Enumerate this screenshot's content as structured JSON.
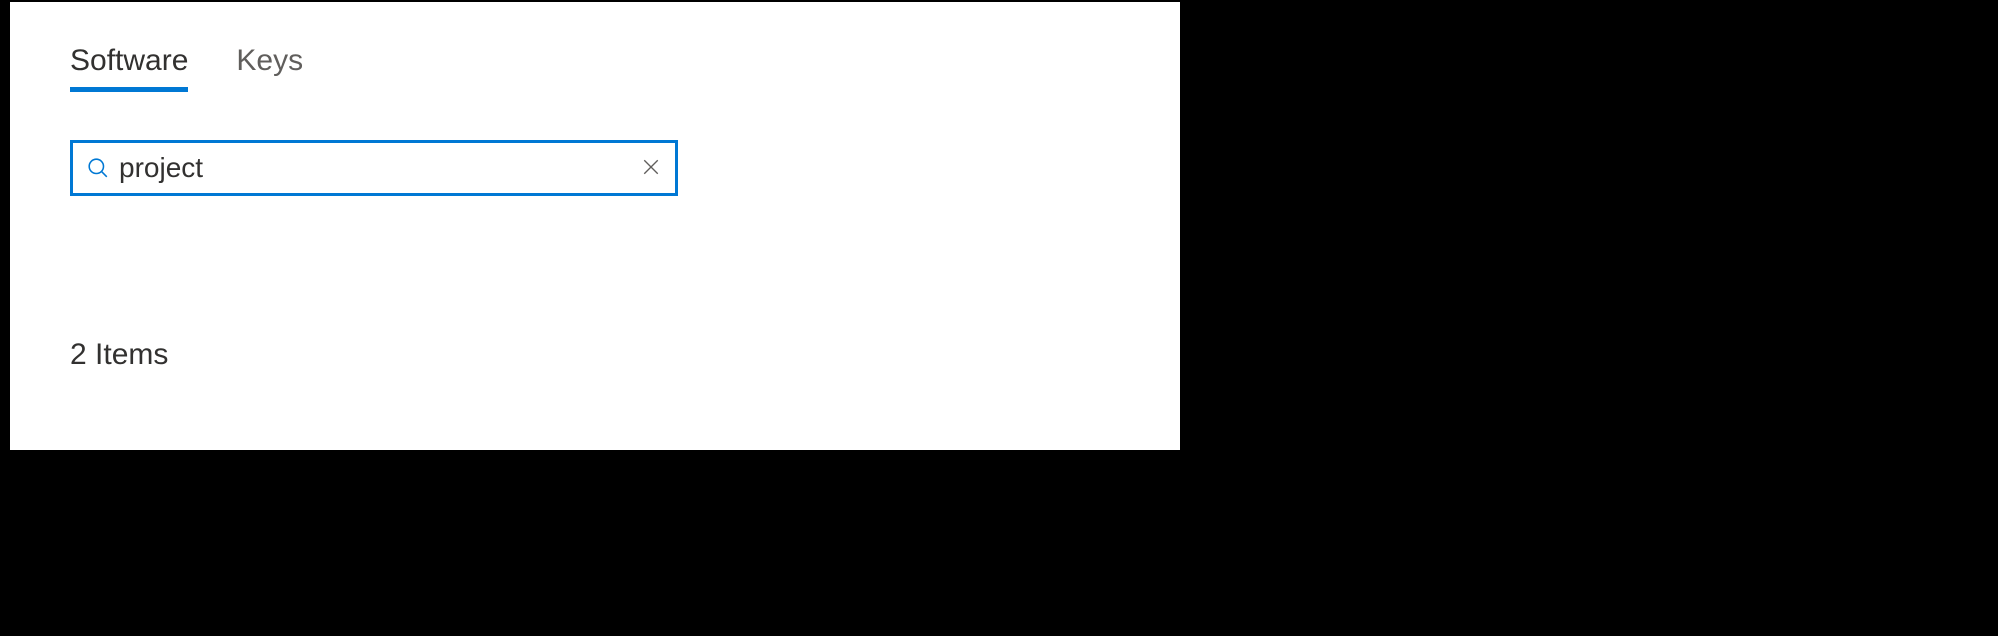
{
  "tabs": [
    {
      "label": "Software",
      "active": true
    },
    {
      "label": "Keys",
      "active": false
    }
  ],
  "search": {
    "value": "project",
    "placeholder": ""
  },
  "results": {
    "count_label": "2 Items"
  },
  "colors": {
    "accent": "#0078d4",
    "text_primary": "#323130",
    "text_secondary": "#605e5c"
  }
}
